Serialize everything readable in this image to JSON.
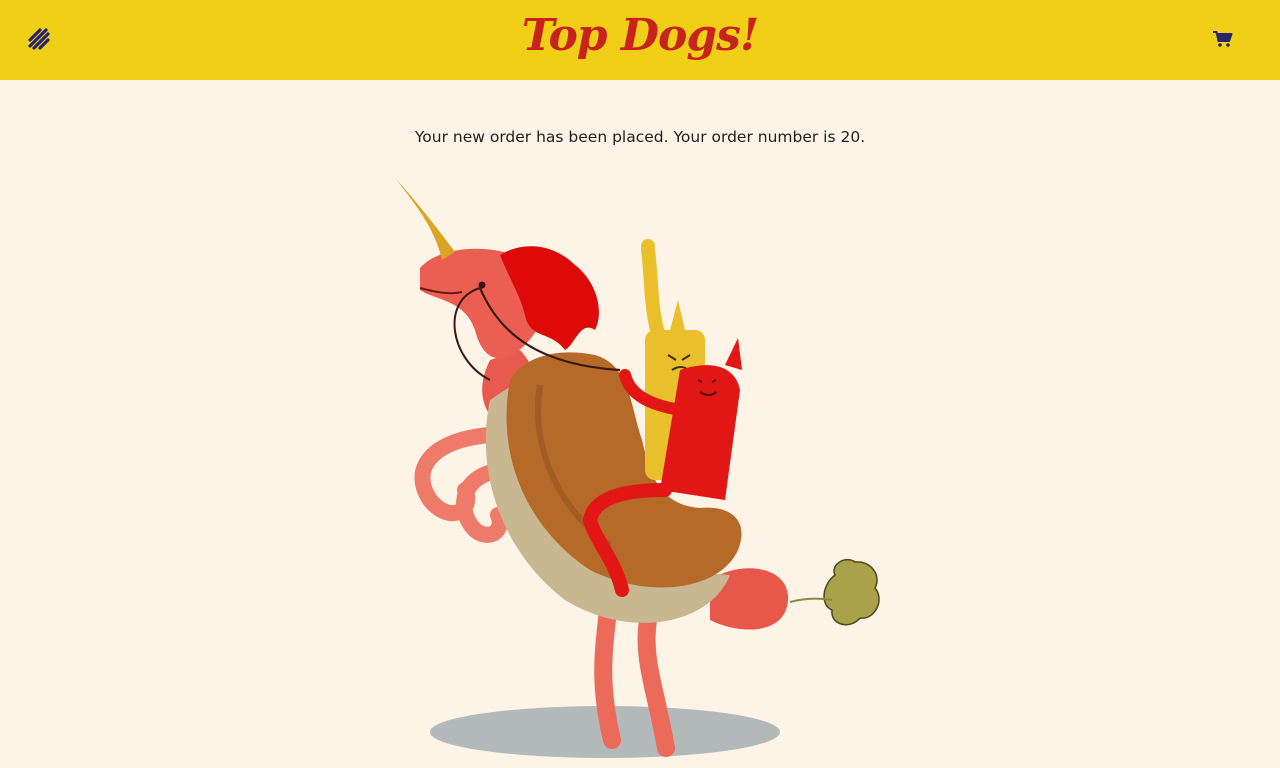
{
  "header": {
    "brand_title": "Top Dogs!",
    "menu_icon": "hotdog-menu-icon",
    "cart_icon": "shopping-cart-icon",
    "background_color": "#f2cf17",
    "brand_color": "#c8221c",
    "icon_color": "#26256b"
  },
  "main": {
    "confirmation_message": "Your new order has been placed. Your order number is 20.",
    "illustration": "hot-dog-unicorn-rodeo-illustration"
  },
  "theme": {
    "page_background": "#fdf4e7"
  }
}
